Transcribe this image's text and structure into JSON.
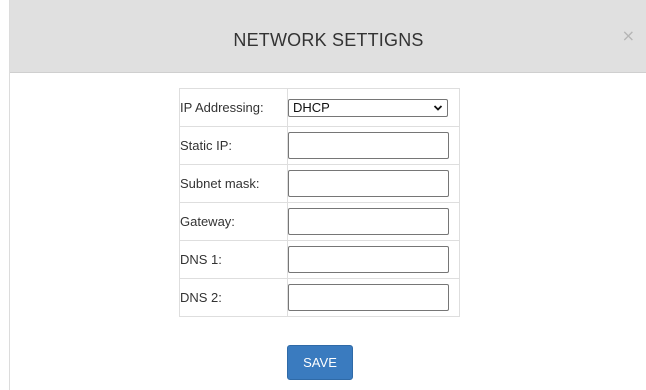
{
  "modal": {
    "title": "NETWORK SETTIGNS",
    "close_icon": "×"
  },
  "form": {
    "ip_addressing": {
      "label": "IP Addressing:",
      "value": "DHCP"
    },
    "static_ip": {
      "label": "Static IP:",
      "value": ""
    },
    "subnet_mask": {
      "label": "Subnet mask:",
      "value": ""
    },
    "gateway": {
      "label": "Gateway:",
      "value": ""
    },
    "dns1": {
      "label": "DNS 1:",
      "value": ""
    },
    "dns2": {
      "label": "DNS 2:",
      "value": ""
    }
  },
  "save_label": "SAVE",
  "icons": {
    "close": "close-icon",
    "dropdown": "chevron-down-icon"
  },
  "colors": {
    "header_bg": "#e0e0e0",
    "save_button": "#3a7bbf"
  }
}
